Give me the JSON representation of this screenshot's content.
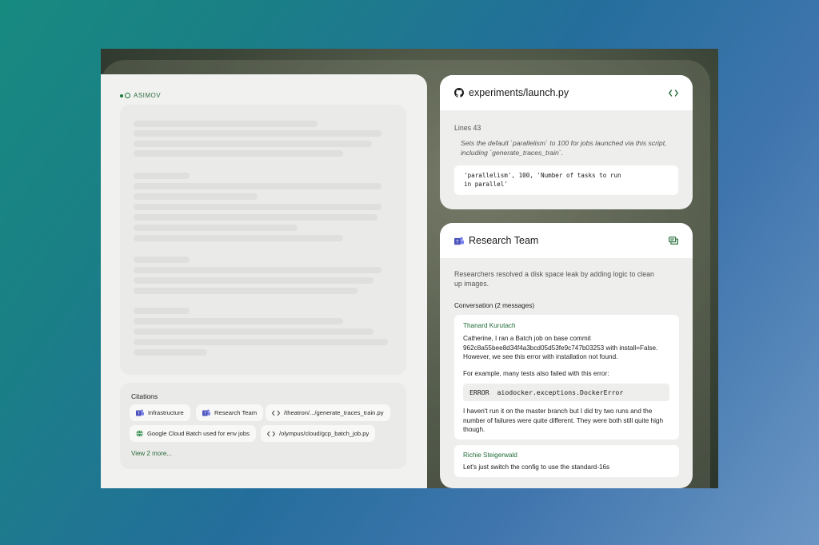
{
  "brand": {
    "name": "ASIMOV"
  },
  "citations": {
    "title": "Citations",
    "chips": [
      {
        "label": "Infrastructure",
        "icon": "teams-icon"
      },
      {
        "label": "Research Team",
        "icon": "teams-icon"
      },
      {
        "label": "/theatron/.../generate_traces_train.py",
        "icon": "code-icon"
      },
      {
        "label": "Google Cloud Batch used for env jobs",
        "icon": "globe-icon"
      },
      {
        "label": "/olympus/cloud/gcp_batch_job.py",
        "icon": "code-icon"
      }
    ],
    "view_more": "View 2 more..."
  },
  "code_card": {
    "title": "experiments/launch.py",
    "icon": "github-icon",
    "lines": "Lines 43",
    "description": "Sets the default `parallelism` to 100 for jobs launched via this script, including `generate_traces_train`.",
    "code_line1": "'parallelism', 100, 'Number of tasks to run",
    "code_line2": "in parallel'"
  },
  "team_card": {
    "title": "Research Team",
    "icon": "teams-icon",
    "summary": "Researchers resolved a disk space leak by adding logic to clean up images.",
    "conversation_title": "Conversation (2 messages)",
    "messages": [
      {
        "author": "Thanard Kurutach",
        "text1": "Catherine, I ran a Batch job on base commit 962c8a55bee8d34f4a3bcd05d53fe9c747b03253 with install=False. However, we see this error with installation not found.",
        "text2": "For example, many tests also failed with this error:",
        "error": "ERROR  aiodocker.exceptions.DockerError",
        "text3": "I haven't run it on the master branch but I did try two runs and the number of failures were quite different. They were both still quite high though."
      },
      {
        "author": "Richie Steigerwald",
        "text1": "Let's just switch the config to use the standard-16s"
      }
    ]
  },
  "colors": {
    "accent_green": "#1f6b34",
    "teams_purple": "#5b5fc7"
  }
}
